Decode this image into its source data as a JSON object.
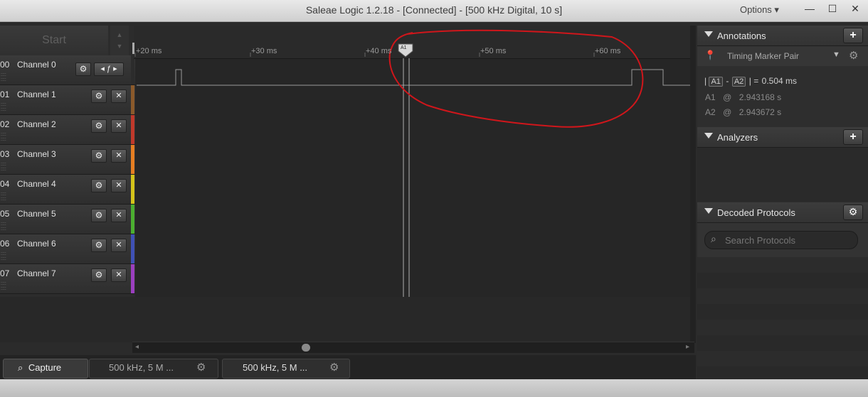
{
  "window": {
    "title": "Saleae Logic 1.2.18 - [Connected] - [500 kHz Digital, 10 s]",
    "options_label": "Options ▾",
    "minimize_glyph": "—",
    "maximize_glyph": "☐",
    "close_glyph": "✕"
  },
  "capture": {
    "start_label": "Start"
  },
  "channels": [
    {
      "num": "00",
      "name": "Channel 0",
      "color": "#2c2c2c",
      "trigger": "ƒ"
    },
    {
      "num": "01",
      "name": "Channel 1",
      "color": "#8b5a2b"
    },
    {
      "num": "02",
      "name": "Channel 2",
      "color": "#c0392b"
    },
    {
      "num": "03",
      "name": "Channel 3",
      "color": "#e67e22"
    },
    {
      "num": "04",
      "name": "Channel 4",
      "color": "#d4c31a"
    },
    {
      "num": "05",
      "name": "Channel 5",
      "color": "#4caf30"
    },
    {
      "num": "06",
      "name": "Channel 6",
      "color": "#3f51b5"
    },
    {
      "num": "07",
      "name": "Channel 7",
      "color": "#9b3fbf"
    }
  ],
  "ruler": {
    "ticks": [
      "+20 ms",
      "+30 ms",
      "+40 ms",
      "+50 ms",
      "+60 ms"
    ],
    "marker_label": "A1"
  },
  "bottom_tabs": [
    {
      "label": "Capture",
      "icon": "search-icon"
    },
    {
      "label": "500 kHz, 5 M ..."
    },
    {
      "label": "500 kHz, 5 M ..."
    }
  ],
  "annotations": {
    "title": "Annotations",
    "add_glyph": "+",
    "marker_pair_label": "Timing Marker Pair",
    "measure": {
      "a1": "A1",
      "a2": "A2",
      "separator": "-",
      "equals": "=",
      "value": "0.504 ms"
    },
    "a1_row": {
      "label": "A1",
      "at": "@",
      "value": "2.943168 s"
    },
    "a2_row": {
      "label": "A2",
      "at": "@",
      "value": "2.943672 s"
    }
  },
  "analyzers": {
    "title": "Analyzers",
    "add_glyph": "+"
  },
  "decoded": {
    "title": "Decoded Protocols",
    "search_placeholder": "Search Protocols"
  },
  "colors": {
    "annotation_circle": "#d0161b",
    "waveform": "#8a8a8a"
  }
}
